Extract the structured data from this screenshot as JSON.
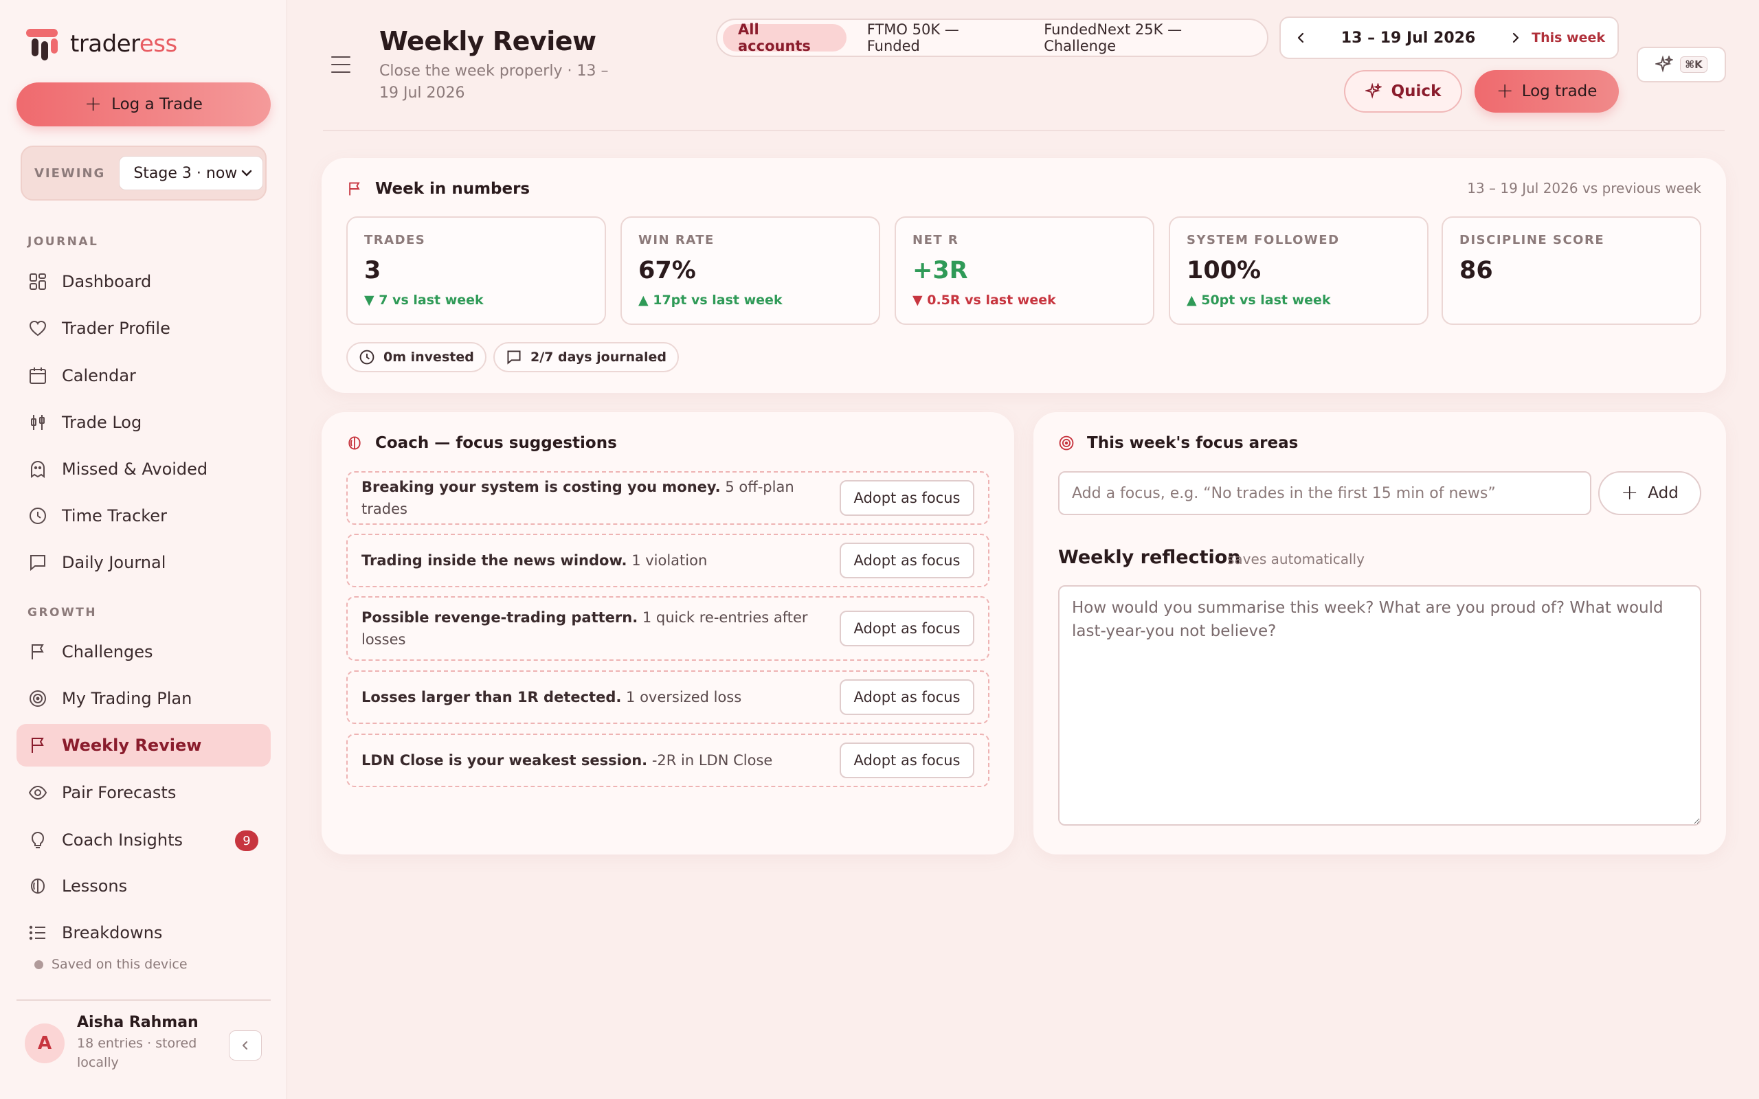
{
  "brand": {
    "name_a": "trader",
    "name_b": "ess"
  },
  "sidebar": {
    "log_trade_label": "Log a Trade",
    "viewing_label": "VIEWING",
    "viewing_value": "Stage 3 · now",
    "section_journal": "JOURNAL",
    "section_growth": "GROWTH",
    "items": [
      {
        "label": "Dashboard",
        "icon": "dashboard-icon"
      },
      {
        "label": "Trader Profile",
        "icon": "heart-icon"
      },
      {
        "label": "Calendar",
        "icon": "calendar-icon"
      },
      {
        "label": "Trade Log",
        "icon": "candles-icon"
      },
      {
        "label": "Missed & Avoided",
        "icon": "ghost-icon"
      },
      {
        "label": "Time Tracker",
        "icon": "clock-icon"
      },
      {
        "label": "Daily Journal",
        "icon": "chat-icon"
      },
      {
        "label": "Challenges",
        "icon": "flag-icon"
      },
      {
        "label": "My Trading Plan",
        "icon": "target-icon"
      },
      {
        "label": "Weekly Review",
        "icon": "flag-icon"
      },
      {
        "label": "Pair Forecasts",
        "icon": "eye-icon"
      },
      {
        "label": "Coach Insights",
        "icon": "bulb-icon",
        "badge": "9"
      },
      {
        "label": "Lessons",
        "icon": "brain-icon"
      },
      {
        "label": "Breakdowns",
        "icon": "list-icon"
      }
    ],
    "saved_note": "Saved on this device",
    "user": {
      "initial": "A",
      "name": "Aisha Rahman",
      "meta": "18 entries · stored locally"
    }
  },
  "header": {
    "title": "Weekly Review",
    "subtitle": "Close the week properly · 13 – 19 Jul 2026",
    "accounts": [
      "All accounts",
      "FTMO 50K — Funded",
      "FundedNext 25K — Challenge"
    ],
    "week_range": "13 – 19 Jul 2026",
    "this_week": "This week",
    "kbd": "⌘K",
    "quick_label": "Quick",
    "log_trade_label": "Log trade"
  },
  "week": {
    "title": "Week in numbers",
    "compare": "13 – 19 Jul 2026 vs previous week",
    "stats": [
      {
        "label": "TRADES",
        "value": "3",
        "delta": "▼ 7 vs last week"
      },
      {
        "label": "WIN RATE",
        "value": "67%",
        "delta": "▲ 17pt vs last week"
      },
      {
        "label": "NET R",
        "value": "+3R",
        "delta": "▼ 0.5R vs last week"
      },
      {
        "label": "SYSTEM FOLLOWED",
        "value": "100%",
        "delta": "▲ 50pt vs last week"
      },
      {
        "label": "DISCIPLINE SCORE",
        "value": "86",
        "delta": ""
      }
    ],
    "chips": [
      "0m invested",
      "2/7 days journaled"
    ]
  },
  "coach": {
    "title": "Coach — focus suggestions",
    "adopt_label": "Adopt as focus",
    "suggestions": [
      {
        "bold": "Breaking your system is costing you money.",
        "detail": "5 off-plan trades"
      },
      {
        "bold": "Trading inside the news window.",
        "detail": "1 violation"
      },
      {
        "bold": "Possible revenge-trading pattern.",
        "detail": "1 quick re-entries after losses"
      },
      {
        "bold": "Losses larger than 1R detected.",
        "detail": "1 oversized loss"
      },
      {
        "bold": "LDN Close is your weakest session.",
        "detail": "-2R in LDN Close"
      }
    ]
  },
  "focus": {
    "title": "This week's focus areas",
    "input_placeholder": "Add a focus, e.g. “No trades in the first 15 min of news”",
    "add_label": "Add",
    "reflection_title": "Weekly reflection",
    "reflection_note": "saves automatically",
    "reflection_placeholder": "How would you summarise this week? What are you proud of? What would last-year-you not believe?"
  },
  "colors": {
    "accent": "#ef6a6e",
    "active_text": "#8a1c2c",
    "green": "#2f9a57",
    "red": "#c7353f"
  }
}
